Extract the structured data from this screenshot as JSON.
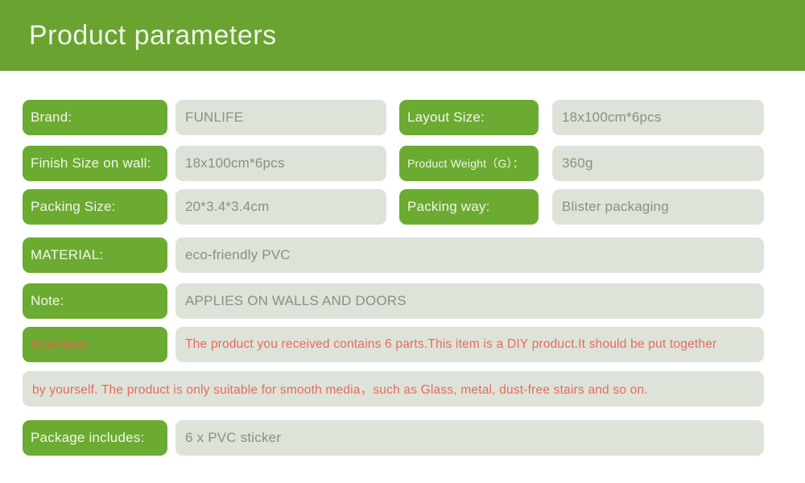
{
  "header": {
    "title": "Product parameters"
  },
  "colors": {
    "banner_green": "#6ba331",
    "label_pill_green": "#6cab31",
    "value_pill_gray": "#dee3d9",
    "value_text_gray": "#8a8f88",
    "attention_red": "#ea6a5a",
    "page_background": "#ffffff"
  },
  "rows": [
    {
      "left": {
        "label": "Brand:",
        "value": "FUNLIFE"
      },
      "right": {
        "label": "Layout Size:",
        "value": "18x100cm*6pcs"
      }
    },
    {
      "left": {
        "label": "Finish Size on wall:",
        "value": "18x100cm*6pcs"
      },
      "right": {
        "label": "Product Weight（G）：",
        "value": "360g"
      }
    },
    {
      "left": {
        "label": "Packing Size:",
        "value": "20*3.4*3.4cm"
      },
      "right": {
        "label": "Packing way:",
        "value": "Blister packaging"
      }
    }
  ],
  "full_rows": [
    {
      "label": "MATERIAL:",
      "value": "eco-friendly PVC"
    },
    {
      "label": "Note:",
      "value": "APPLIES ON WALLS AND DOORS"
    },
    {
      "label": "Attention:",
      "value": "The product you received contains 6 parts.This item is a DIY product.It should be put together",
      "continuation": "by yourself. The product is only suitable for smooth media，such as Glass, metal, dust-free  stairs and so on."
    },
    {
      "label": "Package includes:",
      "value": "6 x PVC sticker"
    }
  ]
}
